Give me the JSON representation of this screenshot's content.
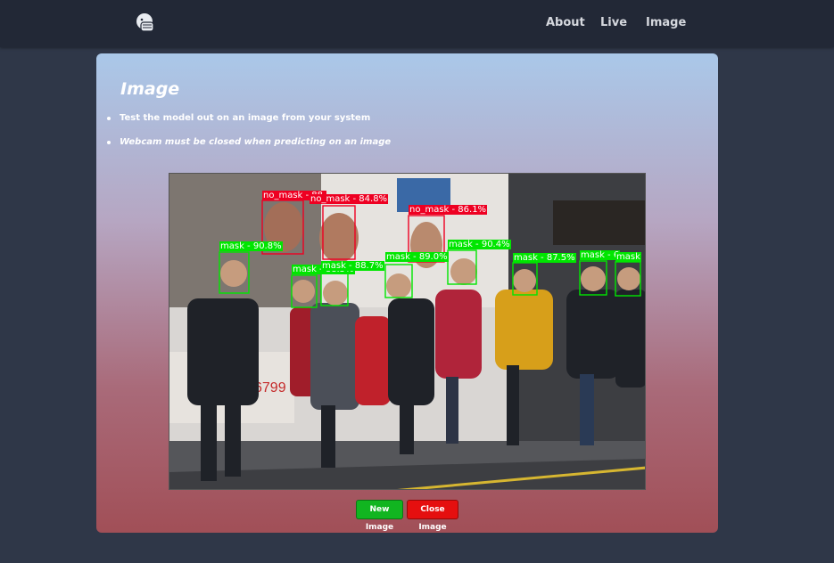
{
  "nav": {
    "logo_icon": "mask-face-icon",
    "links": [
      {
        "label": "About"
      },
      {
        "label": "Live"
      },
      {
        "label": "Image"
      }
    ]
  },
  "card": {
    "title": "Image",
    "bullets": [
      "Test the model out on an image from your system",
      "Webcam must be closed when predicting on an image"
    ]
  },
  "detections": [
    {
      "label": "no_mask - 88.",
      "kind": "no_mask"
    },
    {
      "label": "no_mask - 84.8%",
      "kind": "no_mask"
    },
    {
      "label": "no_mask - 86.1%",
      "kind": "no_mask"
    },
    {
      "label": "mask - 90.8%",
      "kind": "mask"
    },
    {
      "label": "mask - 88.5%",
      "kind": "mask"
    },
    {
      "label": "mask - 88.7%",
      "kind": "mask"
    },
    {
      "label": "mask - 89.0%",
      "kind": "mask"
    },
    {
      "label": "mask - 90.4%",
      "kind": "mask"
    },
    {
      "label": "mask - 87.5%",
      "kind": "mask"
    },
    {
      "label": "mask - 6",
      "kind": "mask"
    },
    {
      "label": "mask",
      "kind": "mask"
    }
  ],
  "buttons": {
    "new_image": "New Image",
    "close_image": "Close Image"
  },
  "colors": {
    "mask": "#00e600",
    "no_mask": "#ee0022",
    "new_button": "#11b520",
    "close_button": "#e50f0f"
  }
}
